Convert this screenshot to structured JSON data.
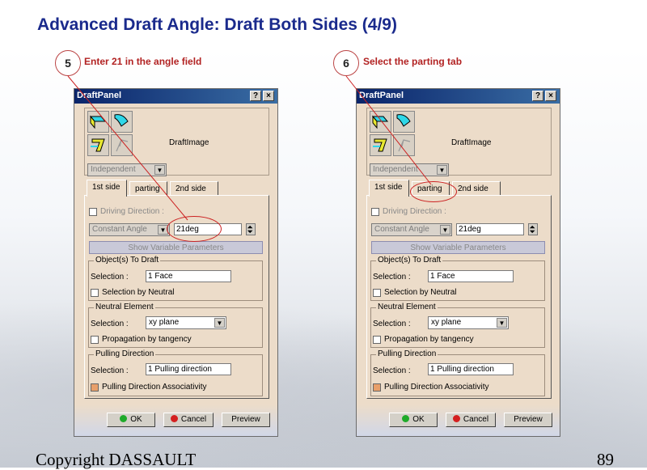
{
  "slide": {
    "title": "Advanced Draft Angle: Draft Both Sides (4/9)",
    "footer_left": "Copyright DASSAULT",
    "page_number": "89"
  },
  "steps": [
    {
      "number": "5",
      "text": "Enter 21 in the angle field"
    },
    {
      "number": "6",
      "text": "Select the parting tab"
    }
  ],
  "panel": {
    "title": "DraftPanel",
    "help_label": "?",
    "close_label": "×",
    "image_label": "DraftImage",
    "mode_select": "Independent",
    "tabs": [
      "1st side",
      "parting",
      "2nd side"
    ],
    "driving_direction": "Driving Direction :",
    "angle_type": "Constant Angle",
    "angle_value": "21deg",
    "show_variable": "Show Variable Parameters",
    "objects_group": "Object(s) To Draft",
    "selection_label": "Selection :",
    "objects_value": "1 Face",
    "selection_by_neutral": "Selection by Neutral",
    "neutral_group": "Neutral Element",
    "neutral_value": "xy plane",
    "propagation": "Propagation by tangency",
    "pulling_group": "Pulling Direction",
    "pulling_value": "1 Pulling direction",
    "pulling_assoc": "Pulling Direction Associativity",
    "ok": "OK",
    "cancel": "Cancel",
    "preview": "Preview"
  }
}
